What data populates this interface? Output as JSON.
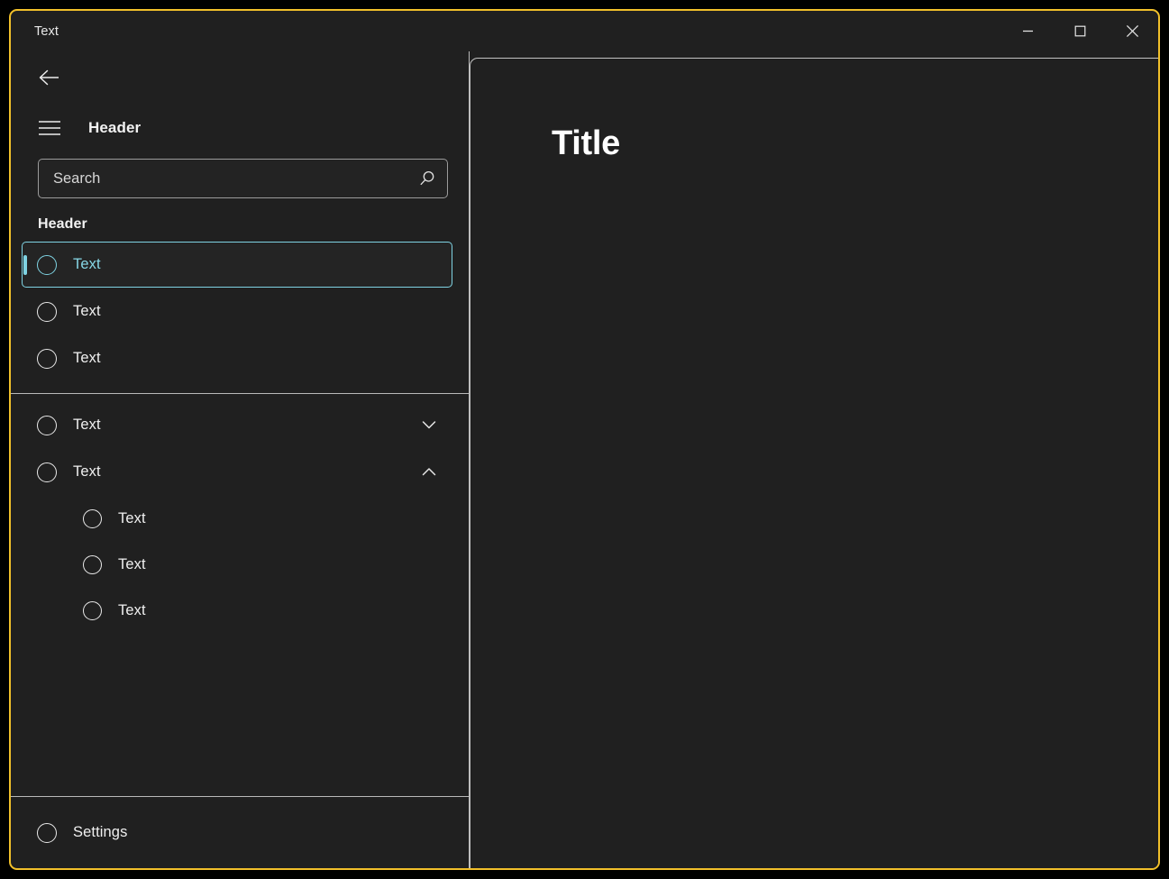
{
  "window": {
    "title": "Text",
    "border_color": "#F1C02A",
    "background": "#202020",
    "caption_buttons": [
      {
        "name": "minimize",
        "glyph": "minimize-icon",
        "label": "Minimize"
      },
      {
        "name": "maximize",
        "glyph": "maximize-icon",
        "label": "Maximize"
      },
      {
        "name": "close",
        "glyph": "close-icon",
        "label": "Close"
      }
    ]
  },
  "sidebar": {
    "back_button": {
      "icon": "back-arrow-icon",
      "label": "Back"
    },
    "menu_button": {
      "icon": "hamburger-menu-icon",
      "label": "Menu"
    },
    "menu_header": "Header",
    "search": {
      "placeholder": "Search",
      "value": "",
      "icon": "search-icon"
    },
    "section_header": "Header",
    "accent_color": "#7FD3E3",
    "primary_items": [
      {
        "label": "Text",
        "icon": "circle-icon",
        "selected": true,
        "expandable": false
      },
      {
        "label": "Text",
        "icon": "circle-icon",
        "selected": false,
        "expandable": false
      },
      {
        "label": "Text",
        "icon": "circle-icon",
        "selected": false,
        "expandable": false
      }
    ],
    "secondary_items": [
      {
        "label": "Text",
        "icon": "circle-icon",
        "selected": false,
        "expandable": true,
        "expanded": false,
        "chevron": "chevron-down-icon"
      },
      {
        "label": "Text",
        "icon": "circle-icon",
        "selected": false,
        "expandable": true,
        "expanded": true,
        "chevron": "chevron-up-icon"
      }
    ],
    "child_items": [
      {
        "label": "Text",
        "icon": "circle-icon"
      },
      {
        "label": "Text",
        "icon": "circle-icon"
      },
      {
        "label": "Text",
        "icon": "circle-icon"
      }
    ],
    "footer_item": {
      "label": "Settings",
      "icon": "circle-icon"
    }
  },
  "content": {
    "title": "Title"
  }
}
